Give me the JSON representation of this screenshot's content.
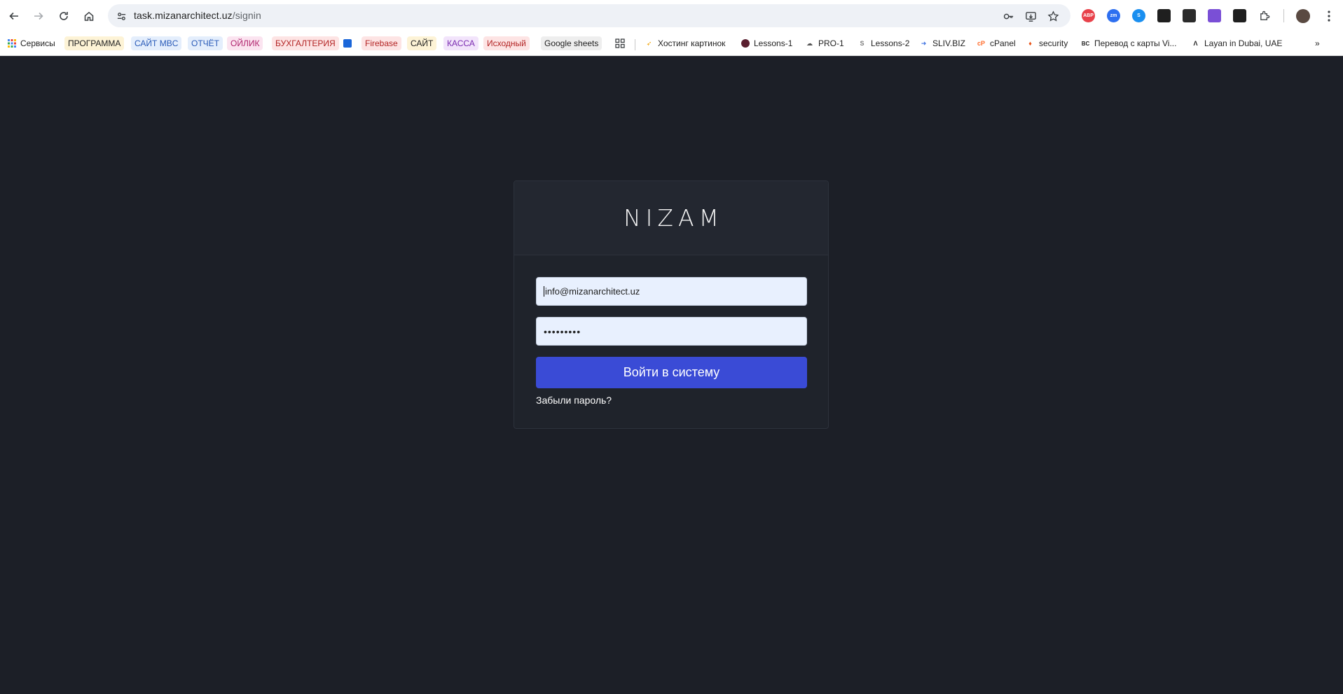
{
  "browser": {
    "url_host": "task.mizanarchitect.uz",
    "url_path": "/signin",
    "extensions": [
      {
        "name": "adblock-plus-icon",
        "label": "ABP",
        "color": "#e8414a"
      },
      {
        "name": "zoom-extension-icon",
        "label": "zm",
        "color": "#2d6ff0"
      },
      {
        "name": "shazam-extension-icon",
        "label": "S",
        "color": "#1a8ff0"
      },
      {
        "name": "vpn-extension-icon",
        "label": "",
        "color": "#1f1f1f"
      },
      {
        "name": "terminal-extension-icon",
        "label": "",
        "color": "#2b2b2b"
      },
      {
        "name": "purple-grid-extension-icon",
        "label": "",
        "color": "#7a4fd6"
      },
      {
        "name": "incognito-extension-icon",
        "label": "",
        "color": "#1f1f1f"
      }
    ]
  },
  "bookmarks": [
    {
      "label": "Сервисы",
      "bg": "",
      "color": "#1f1f1f",
      "icon": "apps-grid-icon"
    },
    {
      "label": "ПРОГРАММА",
      "bg": "#fdf3d6",
      "color": "#1f1f1f"
    },
    {
      "label": "САЙТ MBC",
      "bg": "#e4eefc",
      "color": "#2a5bb8"
    },
    {
      "label": "ОТЧЁТ",
      "bg": "#e4eefc",
      "color": "#2a5bb8"
    },
    {
      "label": "ОЙЛИК",
      "bg": "#fbe4f0",
      "color": "#b0246e"
    },
    {
      "label": "БУХГАЛТЕРИЯ",
      "bg": "#fde4e4",
      "color": "#b32424"
    },
    {
      "label": "",
      "bg": "",
      "color": "#1f1f1f",
      "icon": "blue-square-icon"
    },
    {
      "label": "Firebase",
      "bg": "#fde4e4",
      "color": "#b32424"
    },
    {
      "label": "САЙТ",
      "bg": "#fdf3d6",
      "color": "#1f1f1f"
    },
    {
      "label": "КАССА",
      "bg": "#f2e4fb",
      "color": "#7a2bb0"
    },
    {
      "label": "Исходный",
      "bg": "#fde4e4",
      "color": "#b32424"
    },
    {
      "label": "Google sheets",
      "bg": "#eeeeee",
      "color": "#1f1f1f"
    },
    {
      "label": "Хостинг картинок",
      "bg": "",
      "color": "#1f1f1f",
      "icon": "hosting-icon"
    },
    {
      "label": "Lessons-1",
      "bg": "",
      "color": "#1f1f1f",
      "icon": "lessons-icon"
    },
    {
      "label": "PRO-1",
      "bg": "",
      "color": "#1f1f1f",
      "icon": "cloud-icon"
    },
    {
      "label": "Lessons-2",
      "bg": "",
      "color": "#1f1f1f",
      "icon": "s-icon"
    },
    {
      "label": "SLIV.BIZ",
      "bg": "",
      "color": "#1f1f1f",
      "icon": "arrow-icon"
    },
    {
      "label": "cPanel",
      "bg": "",
      "color": "#1f1f1f",
      "icon": "cpanel-icon"
    },
    {
      "label": "security",
      "bg": "",
      "color": "#1f1f1f",
      "icon": "flame-icon"
    },
    {
      "label": "Перевод с карты Vi...",
      "bg": "",
      "color": "#1f1f1f",
      "icon": "bc-icon"
    },
    {
      "label": "Layan in Dubai, UAE",
      "bg": "",
      "color": "#1f1f1f",
      "icon": "lambda-icon"
    }
  ],
  "login": {
    "logo": "NIZAM",
    "email_value": "info@mizanarchitect.uz",
    "password_value": "•••••••••",
    "submit_label": "Войти в систему",
    "forgot_label": "Забыли пароль?"
  },
  "colors": {
    "page_bg": "#1c1f27",
    "card_bg": "#1f232b",
    "button": "#3a4bd6",
    "input_bg": "#e8f0fe"
  }
}
